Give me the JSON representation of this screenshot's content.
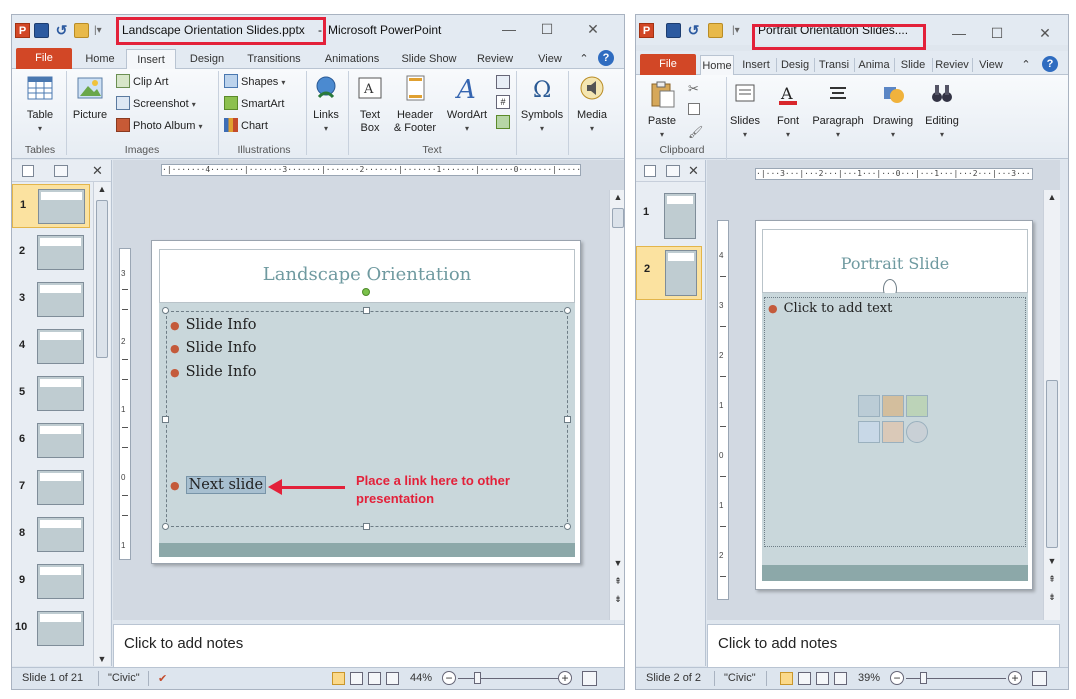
{
  "left": {
    "window_title_file": "Landscape Orientation Slides.pptx",
    "window_title_sep": "-",
    "window_title_app": "Microsoft PowerPoint",
    "tabs": [
      "File",
      "Home",
      "Insert",
      "Design",
      "Transitions",
      "Animations",
      "Slide Show",
      "Review",
      "View"
    ],
    "ribbon": {
      "tables": "Table",
      "tables_group": "Tables",
      "picture": "Picture",
      "clip_art": "Clip Art",
      "screenshot": "Screenshot",
      "photo_album": "Photo Album",
      "images_group": "Images",
      "shapes": "Shapes",
      "smartart": "SmartArt",
      "chart": "Chart",
      "illustrations_group": "Illustrations",
      "links": "Links",
      "text_box_1": "Text",
      "text_box_2": "Box",
      "header_footer_1": "Header",
      "header_footer_2": "& Footer",
      "wordart": "WordArt",
      "text_group": "Text",
      "symbols": "Symbols",
      "media": "Media"
    },
    "thumbnails": [
      "1",
      "2",
      "3",
      "4",
      "5",
      "6",
      "7",
      "8",
      "9",
      "10"
    ],
    "ruler_h": "·|·······4·······|·······3·······|·······2·······|·······1·······|·······0·······|·······1·······|·······2·······|·······3·······|·······4·······|·",
    "slide": {
      "title": "Landscape Orientation",
      "bullets": [
        "Slide Info",
        "Slide Info",
        "Slide Info"
      ],
      "link_bullet": "Next slide"
    },
    "annotation_line1": "Place a link here to other",
    "annotation_line2": "presentation",
    "notes": "Click to add notes",
    "status": {
      "slide": "Slide 1 of 21",
      "theme": "\"Civic\"",
      "zoom": "44%"
    }
  },
  "right": {
    "window_title_file": "Portrait Orientation Slides....",
    "tabs": [
      "File",
      "Home",
      "Insert",
      "Desig",
      "Transi",
      "Anima",
      "Slide",
      "Reviev",
      "View"
    ],
    "ribbon": {
      "paste": "Paste",
      "clipboard_group": "Clipboard",
      "slides": "Slides",
      "font": "Font",
      "paragraph": "Paragraph",
      "drawing": "Drawing",
      "editing": "Editing"
    },
    "thumbnails": [
      "1",
      "2"
    ],
    "ruler_h": "·|···3···|···2···|···1···|···0···|···1···|···2···|···3···|·",
    "slide": {
      "title": "Portrait Slide",
      "bullet": "Click to add text"
    },
    "notes": "Click to add notes",
    "status": {
      "slide": "Slide 2 of 2",
      "theme": "\"Civic\"",
      "zoom": "39%"
    }
  },
  "colors": {
    "file_tab": "#d24726",
    "highlight": "#e3213a",
    "slide_title": "#6f9aa0",
    "slide_body": "#c9d7db",
    "footer_band": "#8ca8a9"
  }
}
